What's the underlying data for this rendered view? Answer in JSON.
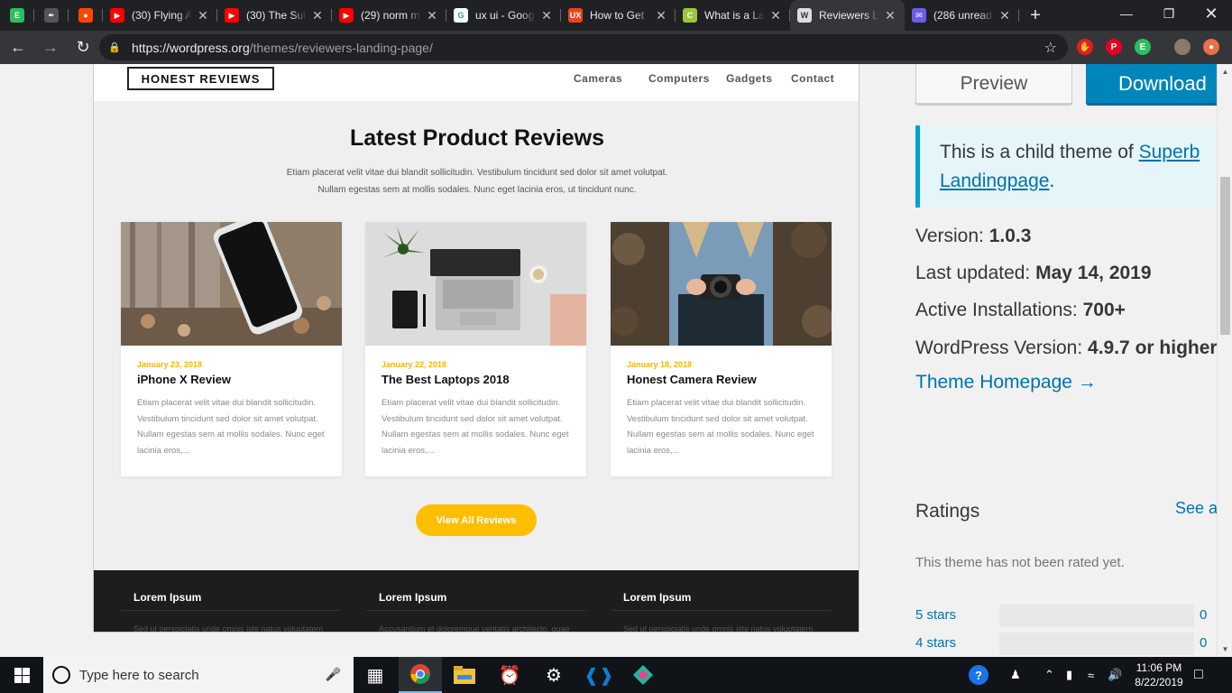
{
  "browser": {
    "tabs": [
      {
        "title": "",
        "icon": "evernote-icon",
        "color": "#2dbe60"
      },
      {
        "title": "",
        "icon": "feather-icon",
        "color": "#555555"
      },
      {
        "title": "",
        "icon": "reddit-icon",
        "color": "#ff4500"
      },
      {
        "title": "(30) Flying A",
        "icon": "youtube-icon",
        "color": "#ff0000"
      },
      {
        "title": "(30) The Sul",
        "icon": "youtube-icon",
        "color": "#ff0000"
      },
      {
        "title": "(29) norm m",
        "icon": "youtube-icon",
        "color": "#ff0000"
      },
      {
        "title": "ux ui - Goog",
        "icon": "google-icon",
        "color": "#ffffff"
      },
      {
        "title": "How to Get",
        "icon": "ux-icon",
        "color": "#e8451e"
      },
      {
        "title": "What is a La",
        "icon": "c-icon",
        "color": "#9bc53d"
      },
      {
        "title": "Reviewers L",
        "icon": "wordpress-icon",
        "color": "#dddddd"
      },
      {
        "title": "(286 unread",
        "icon": "mail-icon",
        "color": "#6c5ce7"
      }
    ],
    "url_host": "https://wordpress.org",
    "url_path": "/themes/reviewers-landing-page/"
  },
  "theme_preview": {
    "logo": "HONEST REVIEWS",
    "nav": [
      "Cameras",
      "Computers",
      "Gadgets",
      "Contact"
    ],
    "title": "Latest Product Reviews",
    "subtitle_line1": "Etiam placerat velit vitae dui blandit sollicitudin. Vestibulum tincidunt sed dolor sit amet volutpat.",
    "subtitle_line2": "Nullam egestas sem at mollis sodales. Nunc eget lacinia eros, ut tincidunt nunc.",
    "cards": [
      {
        "date": "January 23, 2018",
        "title": "iPhone X Review",
        "body": "Etiam placerat velit vitae dui blandit sollicitudin. Vestibulum tincidunt sed dolor sit amet volutpat. Nullam egestas sem at mollis sodales. Nunc eget lacinia eros,..."
      },
      {
        "date": "January 22, 2018",
        "title": "The Best Laptops 2018",
        "body": "Etiam placerat velit vitae dui blandit sollicitudin. Vestibulum tincidunt sed dolor sit amet volutpat. Nullam egestas sem at mollis sodales. Nunc eget lacinia eros,..."
      },
      {
        "date": "January 18, 2018",
        "title": "Honest Camera Review",
        "body": "Etiam placerat velit vitae dui blandit sollicitudin. Vestibulum tincidunt sed dolor sit amet volutpat. Nullam egestas sem at mollis sodales. Nunc eget lacinia eros,..."
      }
    ],
    "view_all": "View All Reviews",
    "footer_titles": [
      "Lorem Ipsum",
      "Lorem Ipsum",
      "Lorem Ipsum"
    ],
    "footer_texts": [
      "Sed ut perspiciatis unde omnis iste natus voluptatem",
      "Accusantium et doloremque veritatis architecto, quae",
      "Sed ut perspiciatis unde omnis iste natus voluptatem"
    ]
  },
  "sidebar": {
    "preview_label": "Preview",
    "download_label": "Download",
    "notice_prefix": "This is a child theme of ",
    "notice_link": "Superb Landingpage",
    "notice_suffix": ".",
    "version_label": "Version: ",
    "version_value": "1.0.3",
    "updated_label": "Last updated: ",
    "updated_value": "May 14, 2019",
    "installs_label": "Active Installations: ",
    "installs_value": "700+",
    "wp_label": "WordPress Version: ",
    "wp_value": "4.9.7 or higher",
    "homepage_link": "Theme Homepage →",
    "ratings_heading": "Ratings",
    "see_all": "See all",
    "not_rated": "This theme has not been rated yet.",
    "star_rows": [
      {
        "label": "5 stars",
        "count": "0"
      },
      {
        "label": "4 stars",
        "count": "0"
      }
    ]
  },
  "taskbar": {
    "search_placeholder": "Type here to search",
    "time": "11:06 PM",
    "date": "8/22/2019"
  }
}
